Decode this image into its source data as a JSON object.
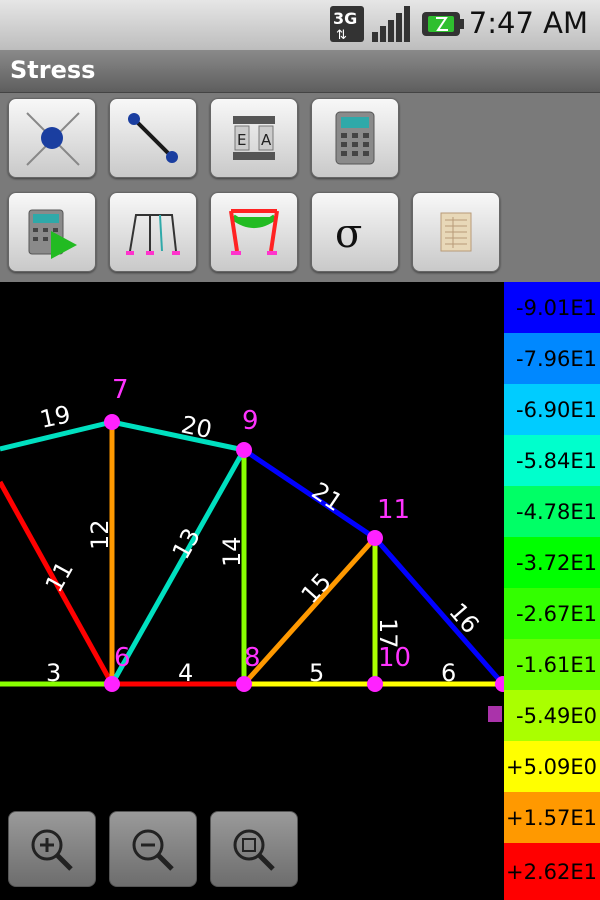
{
  "status": {
    "network": "3G",
    "time": "7:47 AM"
  },
  "title": "Stress",
  "toolbar": {
    "buttons": [
      {
        "icon": "node-icon"
      },
      {
        "icon": "member-icon"
      },
      {
        "icon": "ea-section-icon",
        "text": "E A"
      },
      {
        "icon": "calculator-icon"
      },
      {
        "icon": "run-analysis-icon"
      },
      {
        "icon": "frame-icon"
      },
      {
        "icon": "deformed-frame-icon"
      },
      {
        "icon": "stress-icon",
        "text": "σ"
      },
      {
        "icon": "report-icon"
      }
    ]
  },
  "truss": {
    "node_labels": [
      "7",
      "9",
      "11",
      "6",
      "8",
      "10"
    ],
    "member_labels": [
      "19",
      "20",
      "21",
      "12",
      "13",
      "14",
      "11",
      "15",
      "17",
      "16",
      "3",
      "4",
      "5",
      "6"
    ]
  },
  "legend": {
    "items": [
      {
        "label": "-9.01E1",
        "color": "#0000ff"
      },
      {
        "label": "-7.96E1",
        "color": "#0088ff"
      },
      {
        "label": "-6.90E1",
        "color": "#00ccff"
      },
      {
        "label": "-5.84E1",
        "color": "#00ffcc"
      },
      {
        "label": "-4.78E1",
        "color": "#00ff66"
      },
      {
        "label": "-3.72E1",
        "color": "#00ff00"
      },
      {
        "label": "-2.67E1",
        "color": "#33ff00"
      },
      {
        "label": "-1.61E1",
        "color": "#66ff00"
      },
      {
        "label": "-5.49E0",
        "color": "#aaff00"
      },
      {
        "label": "+5.09E0",
        "color": "#ffff00"
      },
      {
        "label": "+1.57E1",
        "color": "#ff9900"
      },
      {
        "label": "+2.62E1",
        "color": "#ff0000"
      }
    ]
  },
  "zoom": {
    "buttons": [
      {
        "icon": "zoom-in-icon"
      },
      {
        "icon": "zoom-out-icon"
      },
      {
        "icon": "zoom-fit-icon"
      }
    ]
  }
}
